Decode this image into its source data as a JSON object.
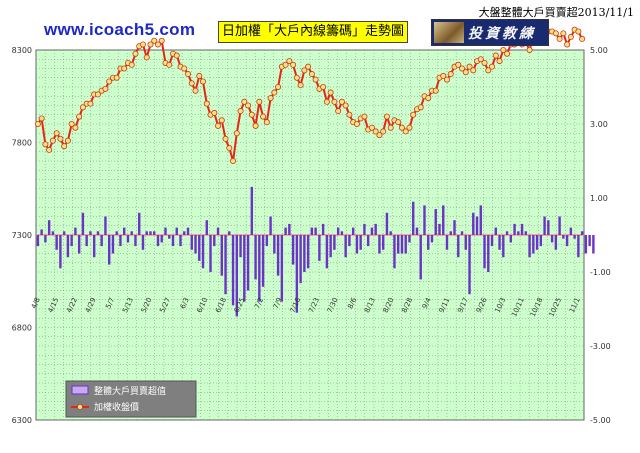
{
  "header": {
    "site": "www.icoach5.com",
    "title": "日加權「大戶內線籌碼」走勢圖",
    "logo_text": "投資教練",
    "corner": "大盤整體大戶買賣超2013/11/1"
  },
  "colors": {
    "plot_bg": "#ccffcc",
    "grid": "#888888",
    "bars": "#6a34c8",
    "line": "#ee2211",
    "marker_fill": "#ffe27a",
    "zero_line": "#ff8888"
  },
  "chart_data": {
    "type": "bar+line",
    "left_axis": {
      "ticks": [
        "6300",
        "6800",
        "7300",
        "7800",
        "8300"
      ],
      "range": [
        6300,
        8300
      ]
    },
    "right_axis": {
      "ticks": [
        "5.00",
        "3.00",
        "1.00",
        "-1.00",
        "-3.00",
        "-5.00"
      ],
      "range": [
        -5,
        5
      ]
    },
    "x_tick_labels": [
      "4/8",
      "4/15",
      "4/22",
      "4/29",
      "5/7",
      "5/13",
      "5/20",
      "5/27",
      "6/3",
      "6/10",
      "6/18",
      "6/25",
      "7/2",
      "7/9",
      "7/16",
      "7/23",
      "7/30",
      "8/6",
      "8/13",
      "8/20",
      "8/28",
      "9/4",
      "9/11",
      "9/17",
      "9/26",
      "10/3",
      "10/11",
      "10/18",
      "10/25",
      "11/1"
    ],
    "legend": [
      {
        "name": "整體大戶買賣超值",
        "kind": "bar"
      },
      {
        "name": "加權收盤價",
        "kind": "line"
      }
    ],
    "series": [
      {
        "name": "加權收盤價",
        "kind": "line",
        "axis": "left",
        "values": [
          7900,
          7930,
          7790,
          7760,
          7810,
          7850,
          7820,
          7780,
          7810,
          7900,
          7880,
          7940,
          7990,
          8010,
          8010,
          8060,
          8060,
          8080,
          8090,
          8130,
          8150,
          8150,
          8200,
          8200,
          8230,
          8220,
          8280,
          8320,
          8330,
          8260,
          8330,
          8350,
          8330,
          8350,
          8230,
          8220,
          8280,
          8270,
          8210,
          8200,
          8170,
          8120,
          8080,
          8160,
          8130,
          8010,
          7950,
          7960,
          7890,
          7920,
          7820,
          7770,
          7700,
          7850,
          7970,
          8020,
          8000,
          7950,
          7890,
          8020,
          7940,
          7910,
          8040,
          8070,
          8100,
          8210,
          8220,
          8240,
          8220,
          8150,
          8110,
          8190,
          8210,
          8170,
          8140,
          8090,
          8100,
          8020,
          8070,
          8020,
          7970,
          8020,
          8000,
          7950,
          7910,
          7900,
          7930,
          7940,
          7870,
          7880,
          7860,
          7840,
          7860,
          7940,
          7880,
          7920,
          7910,
          7880,
          7860,
          7880,
          7950,
          7980,
          7990,
          8050,
          8040,
          8080,
          8080,
          8150,
          8160,
          8140,
          8170,
          8210,
          8220,
          8200,
          8180,
          8210,
          8190,
          8240,
          8250,
          8230,
          8190,
          8210,
          8270,
          8240,
          8300,
          8280,
          8330,
          8330,
          8340,
          8330,
          8340,
          8300,
          8370,
          8370,
          8360,
          8380,
          8400,
          8400,
          8390,
          8360,
          8390,
          8330,
          8370,
          8410,
          8400,
          8360
        ]
      },
      {
        "name": "整體大戶買賣超值",
        "kind": "bar",
        "axis": "right",
        "values": [
          -0.3,
          0.15,
          -0.2,
          0.4,
          0.1,
          -0.4,
          -0.9,
          0.1,
          -0.6,
          -0.3,
          0.2,
          -0.5,
          0.6,
          -0.3,
          0.1,
          -0.6,
          0.1,
          -0.3,
          0.5,
          -0.8,
          -0.5,
          0.1,
          -0.3,
          0.2,
          -0.2,
          0.1,
          -0.3,
          0.6,
          -0.4,
          0.1,
          0.1,
          0.1,
          -0.3,
          -0.2,
          0.2,
          -0.1,
          -0.3,
          0.2,
          -0.3,
          0.1,
          0.2,
          -0.4,
          -0.5,
          -0.7,
          -0.9,
          0.4,
          -1.0,
          -0.3,
          0.2,
          -1.1,
          -1.6,
          0.1,
          -1.9,
          -2.2,
          -0.6,
          -1.8,
          -1.5,
          1.3,
          -1.2,
          -1.8,
          -1.4,
          -0.3,
          0.5,
          -0.5,
          -1.1,
          -1.8,
          0.2,
          0.3,
          -0.8,
          -2.1,
          -1.3,
          -1.0,
          -0.9,
          0.2,
          0.2,
          -0.7,
          0.3,
          -0.9,
          -0.6,
          -0.4,
          0.2,
          0.1,
          -0.6,
          -0.3,
          0.2,
          -0.5,
          -0.4,
          0.3,
          -0.3,
          0.2,
          0.3,
          -0.5,
          -0.4,
          0.6,
          0.1,
          -0.9,
          -0.5,
          -0.5,
          -0.5,
          -0.2,
          0.9,
          0.2,
          -1.2,
          0.8,
          -0.4,
          -0.2,
          0.7,
          0.3,
          0.8,
          -0.4,
          0.1,
          0.4,
          -0.6,
          0.1,
          -0.4,
          -1.6,
          0.6,
          0.5,
          0.8,
          -0.9,
          -1.0,
          -0.3,
          0.2,
          -0.4,
          -0.6,
          0.1,
          -0.2,
          0.3,
          0.1,
          0.3,
          0.1,
          -0.6,
          -0.5,
          -0.4,
          -0.3,
          0.5,
          0.4,
          -0.2,
          -0.4,
          0.5,
          -0.1,
          -0.3,
          0.2,
          -0.1,
          -0.6,
          0.1,
          -0.5,
          -0.3,
          -0.5
        ]
      }
    ]
  }
}
